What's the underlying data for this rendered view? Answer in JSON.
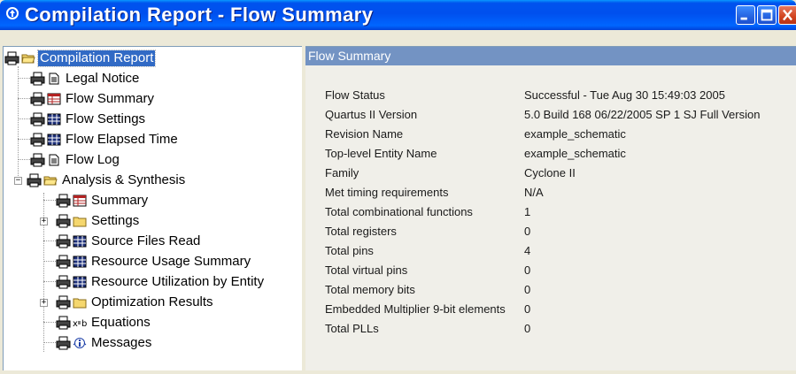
{
  "window": {
    "title": "Compilation Report - Flow Summary",
    "title_color": "#ffffff",
    "titlebar_color": "#0053ee"
  },
  "tree": {
    "items": [
      {
        "label": "Compilation Report",
        "icon": "folder-open-icon",
        "selected": true
      },
      {
        "label": "Legal Notice",
        "icon": "document-icon"
      },
      {
        "label": "Flow Summary",
        "icon": "table-summary-icon"
      },
      {
        "label": "Flow Settings",
        "icon": "table-icon"
      },
      {
        "label": "Flow Elapsed Time",
        "icon": "table-icon"
      },
      {
        "label": "Flow Log",
        "icon": "document-icon"
      },
      {
        "label": "Analysis & Synthesis",
        "icon": "folder-open-icon",
        "expanded": true
      },
      {
        "label": "Summary",
        "icon": "table-summary-icon"
      },
      {
        "label": "Settings",
        "icon": "folder-icon",
        "collapsed": true
      },
      {
        "label": "Source Files Read",
        "icon": "table-icon"
      },
      {
        "label": "Resource Usage Summary",
        "icon": "table-icon"
      },
      {
        "label": "Resource Utilization by Entity",
        "icon": "table-icon"
      },
      {
        "label": "Optimization Results",
        "icon": "folder-icon",
        "collapsed": true
      },
      {
        "label": "Equations",
        "icon": "equations-icon"
      },
      {
        "label": "Messages",
        "icon": "messages-icon"
      }
    ],
    "selection_color": "#316ac5"
  },
  "summary": {
    "header": "Flow Summary",
    "header_color": "#7393c3",
    "rows": [
      {
        "key": "Flow Status",
        "value": "Successful - Tue Aug 30 15:49:03 2005"
      },
      {
        "key": "Quartus II Version",
        "value": "5.0 Build 168 06/22/2005 SP 1 SJ Full Version"
      },
      {
        "key": "Revision Name",
        "value": "example_schematic"
      },
      {
        "key": "Top-level Entity Name",
        "value": "example_schematic"
      },
      {
        "key": "Family",
        "value": "Cyclone II"
      },
      {
        "key": "Met timing requirements",
        "value": "N/A"
      },
      {
        "key": "Total combinational functions",
        "value": "1"
      },
      {
        "key": "Total registers",
        "value": "0"
      },
      {
        "key": "Total pins",
        "value": "4"
      },
      {
        "key": "Total virtual pins",
        "value": "0"
      },
      {
        "key": "Total memory bits",
        "value": "0"
      },
      {
        "key": "Embedded Multiplier 9-bit elements",
        "value": "0"
      },
      {
        "key": "Total PLLs",
        "value": "0"
      }
    ]
  }
}
